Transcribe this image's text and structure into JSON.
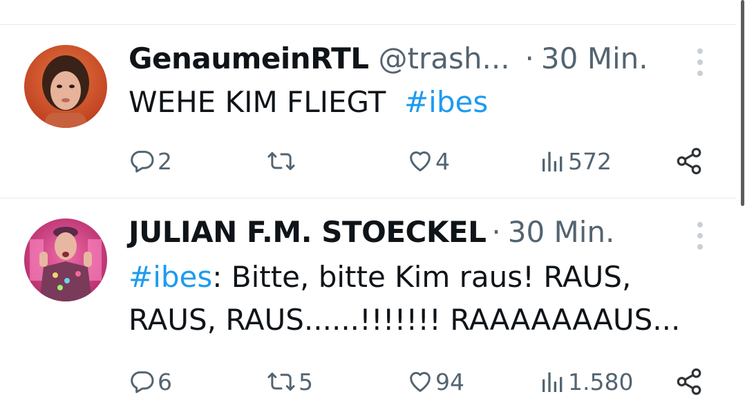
{
  "tweets": [
    {
      "author_name": "GenaumeinRTL",
      "handle": "@trash...",
      "separator": "·",
      "time": "30 Min.",
      "text_plain": "WEHE KIM FLIEGT  ",
      "hashtag": "#ibes",
      "replies": "2",
      "retweets": "",
      "likes": "4",
      "views": "572"
    },
    {
      "author_name": "JULIAN F.M. STOECKEL",
      "separator": "·",
      "time": "30 Min.",
      "hashtag": "#ibes",
      "text_line1_rest": ": Bitte, bitte Kim raus! RAUS,",
      "text_line2": "RAUS, RAUS......!!!!!!! RAAAAAAAUS...",
      "replies": "6",
      "retweets": "5",
      "likes": "94",
      "views": "1.580"
    }
  ],
  "icons": {
    "reply": "reply-icon",
    "retweet": "retweet-icon",
    "like": "heart-icon",
    "views": "views-icon",
    "share": "share-icon",
    "more": "more-icon"
  },
  "colors": {
    "hashtag": "#1d9bf0",
    "secondary_text": "#536471",
    "divider": "#e6e9ec"
  }
}
